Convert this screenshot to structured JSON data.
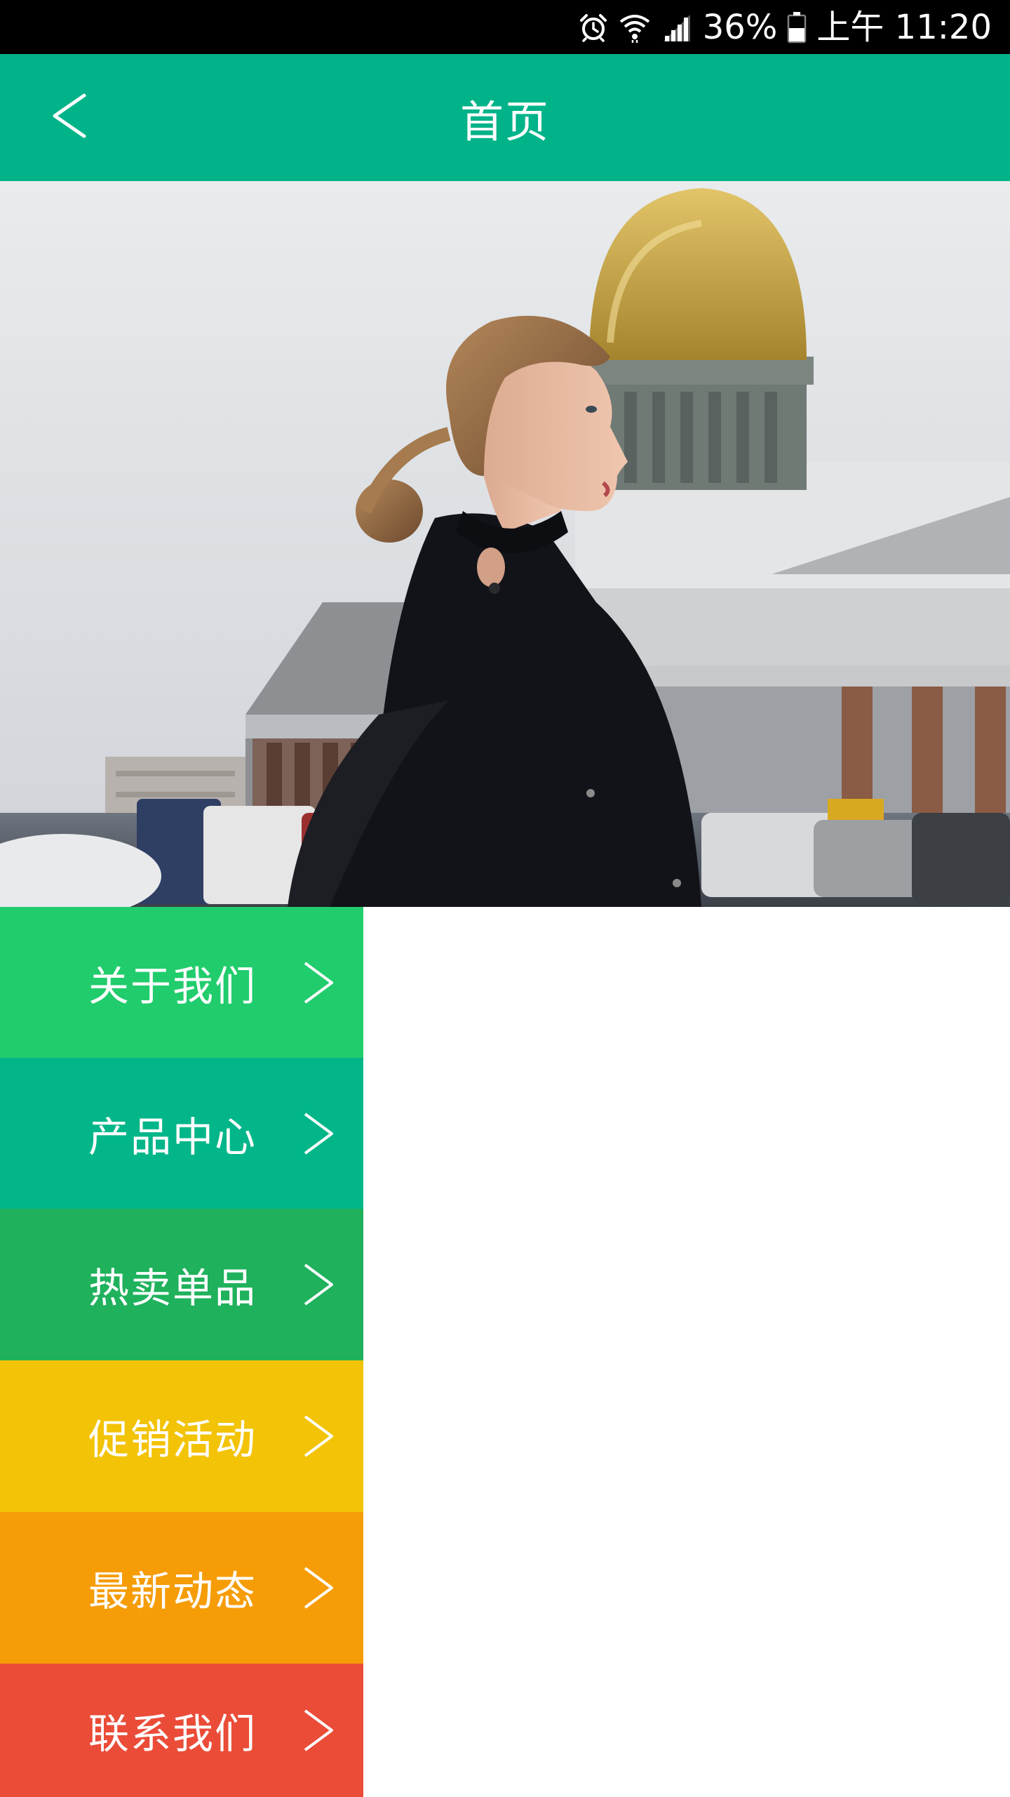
{
  "status_bar": {
    "battery_percent": "36%",
    "time": "上午 11:20",
    "icons": [
      "alarm-icon",
      "wifi-icon",
      "signal-icon",
      "battery-icon"
    ]
  },
  "app_bar": {
    "title": "首页",
    "back_icon": "chevron-left-icon",
    "background": "#00b388"
  },
  "carousel": {
    "slide_count": 5,
    "active_index": 0
  },
  "menu": {
    "items": [
      {
        "label": "关于我们",
        "color": "#21cc6c",
        "icon": "chevron-right-icon"
      },
      {
        "label": "产品中心",
        "color": "#02b689",
        "icon": "chevron-right-icon"
      },
      {
        "label": "热卖单品",
        "color": "#1fb15c",
        "icon": "chevron-right-icon"
      },
      {
        "label": "促销活动",
        "color": "#f2c306",
        "icon": "chevron-right-icon"
      },
      {
        "label": "最新动态",
        "color": "#f59c07",
        "icon": "chevron-right-icon"
      },
      {
        "label": "联系我们",
        "color": "#ea4c38",
        "icon": "chevron-right-icon"
      }
    ]
  }
}
